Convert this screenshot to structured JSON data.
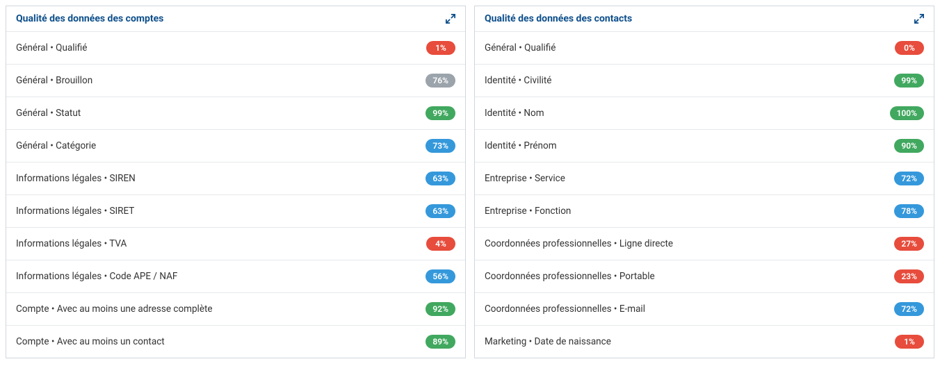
{
  "panels": [
    {
      "title": "Qualité des données des comptes",
      "rows": [
        {
          "label": "Général • Qualifié",
          "value": "1%",
          "color": "red"
        },
        {
          "label": "Général • Brouillon",
          "value": "76%",
          "color": "gray"
        },
        {
          "label": "Général • Statut",
          "value": "99%",
          "color": "green"
        },
        {
          "label": "Général • Catégorie",
          "value": "73%",
          "color": "blue"
        },
        {
          "label": "Informations légales • SIREN",
          "value": "63%",
          "color": "blue"
        },
        {
          "label": "Informations légales • SIRET",
          "value": "63%",
          "color": "blue"
        },
        {
          "label": "Informations légales • TVA",
          "value": "4%",
          "color": "red"
        },
        {
          "label": "Informations légales • Code APE / NAF",
          "value": "56%",
          "color": "blue"
        },
        {
          "label": "Compte • Avec au moins une adresse complète",
          "value": "92%",
          "color": "green"
        },
        {
          "label": "Compte • Avec au moins un contact",
          "value": "89%",
          "color": "green"
        }
      ]
    },
    {
      "title": "Qualité des données des contacts",
      "rows": [
        {
          "label": "Général • Qualifié",
          "value": "0%",
          "color": "red"
        },
        {
          "label": "Identité • Civilité",
          "value": "99%",
          "color": "green"
        },
        {
          "label": "Identité • Nom",
          "value": "100%",
          "color": "green"
        },
        {
          "label": "Identité • Prénom",
          "value": "90%",
          "color": "green"
        },
        {
          "label": "Entreprise • Service",
          "value": "72%",
          "color": "blue"
        },
        {
          "label": "Entreprise • Fonction",
          "value": "78%",
          "color": "blue"
        },
        {
          "label": "Coordonnées professionnelles • Ligne directe",
          "value": "27%",
          "color": "red"
        },
        {
          "label": "Coordonnées professionnelles • Portable",
          "value": "23%",
          "color": "red"
        },
        {
          "label": "Coordonnées professionnelles • E-mail",
          "value": "72%",
          "color": "blue"
        },
        {
          "label": "Marketing • Date de naissance",
          "value": "1%",
          "color": "red"
        }
      ]
    }
  ]
}
